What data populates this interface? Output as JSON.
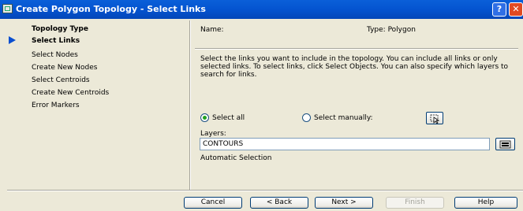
{
  "window": {
    "title": "Create Polygon Topology - Select Links",
    "help_label": "?",
    "close_label": "✕"
  },
  "steps": [
    {
      "label": "Topology Type"
    },
    {
      "label": "Select Links"
    },
    {
      "label": "Select Nodes"
    },
    {
      "label": "Create New Nodes"
    },
    {
      "label": "Select Centroids"
    },
    {
      "label": "Create New Centroids"
    },
    {
      "label": "Error Markers"
    }
  ],
  "header": {
    "name_label": "Name:",
    "type_label": "Type: Polygon"
  },
  "description": "Select the links you want to include in the topology. You can include all links or only selected links. To select links, click Select Objects. You can also specify which layers to search for links.",
  "selection": {
    "select_all_label": "Select all",
    "select_all_checked": true,
    "select_manually_label": "Select manually:",
    "select_manually_checked": false
  },
  "layers": {
    "label": "Layers:",
    "value": "CONTOURS"
  },
  "automatic_selection": "Automatic Selection",
  "footer": {
    "cancel": "Cancel",
    "back": "< Back",
    "next": "Next >",
    "finish": "Finish",
    "help": "Help"
  }
}
